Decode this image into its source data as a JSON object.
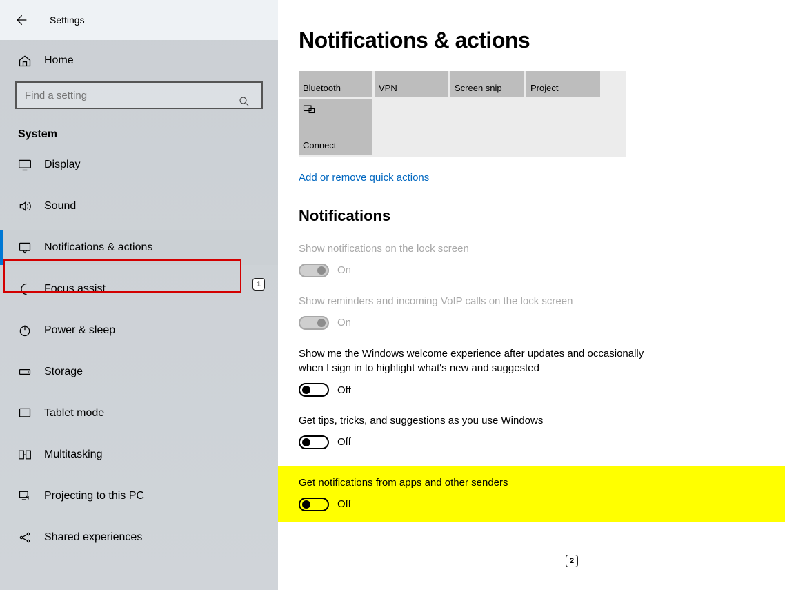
{
  "header": {
    "title": "Settings"
  },
  "sidebar": {
    "home_label": "Home",
    "search_placeholder": "Find a setting",
    "section_label": "System",
    "items": [
      {
        "label": "Display",
        "icon": "monitor-icon"
      },
      {
        "label": "Sound",
        "icon": "speaker-icon"
      },
      {
        "label": "Notifications & actions",
        "icon": "notification-icon",
        "selected": true
      },
      {
        "label": "Focus assist",
        "icon": "moon-icon"
      },
      {
        "label": "Power & sleep",
        "icon": "power-icon"
      },
      {
        "label": "Storage",
        "icon": "storage-icon"
      },
      {
        "label": "Tablet mode",
        "icon": "tablet-icon"
      },
      {
        "label": "Multitasking",
        "icon": "multitask-icon"
      },
      {
        "label": "Projecting to this PC",
        "icon": "project-icon"
      },
      {
        "label": "Shared experiences",
        "icon": "share-icon"
      }
    ]
  },
  "main": {
    "page_title": "Notifications & actions",
    "quick_tiles": [
      {
        "label": "Bluetooth"
      },
      {
        "label": "VPN"
      },
      {
        "label": "Screen snip"
      },
      {
        "label": "Project"
      },
      {
        "label": "Connect",
        "icon": "connect-icon",
        "big": true
      }
    ],
    "link_text": "Add or remove quick actions",
    "notifications_heading": "Notifications",
    "settings": [
      {
        "label": "Show notifications on the lock screen",
        "state": "On",
        "disabled": true
      },
      {
        "label": "Show reminders and incoming VoIP calls on the lock screen",
        "state": "On",
        "disabled": true
      },
      {
        "label": "Show me the Windows welcome experience after updates and occasionally when I sign in to highlight what's new and suggested",
        "state": "Off",
        "disabled": false
      },
      {
        "label": "Get tips, tricks, and suggestions as you use Windows",
        "state": "Off",
        "disabled": false
      },
      {
        "label": "Get notifications from apps and other senders",
        "state": "Off",
        "disabled": false,
        "highlight": true
      }
    ]
  },
  "annotations": {
    "badge1": "1",
    "badge2": "2"
  }
}
